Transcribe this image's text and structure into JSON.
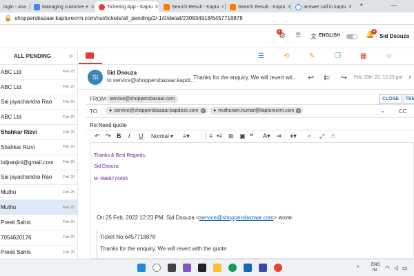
{
  "browser": {
    "tabs": [
      {
        "label": "login - ana",
        "color": "#f2a900"
      },
      {
        "label": "Managing customer e",
        "color": "#4285f4"
      },
      {
        "label": "Ticketing App - Kaptu",
        "color": "#e53935"
      },
      {
        "label": "Search Result - Kaptu",
        "color": "#f57c00"
      },
      {
        "label": "Search Result - Kaptu",
        "color": "#f57c00"
      },
      {
        "label": "answer call in kaptu",
        "color": "#4285f4"
      }
    ],
    "new_tab": "+",
    "url": "shoppersbazaar.kapturecrm.com/nui/tickets/all_pending/2/-1/0/detail/230834918/6457718878"
  },
  "app_header": {
    "notif_count": "6",
    "language": "ENGLISH",
    "user_name": "Sid Dsouza"
  },
  "list": {
    "title": "ALL PENDING",
    "items": [
      {
        "name": "ABC Ltd",
        "date": "Feb 25",
        "bold": false,
        "selected": false
      },
      {
        "name": "ABC Ltd",
        "date": "Feb 25",
        "bold": false,
        "selected": false
      },
      {
        "name": "Sai jayachandra Rao",
        "date": "Feb 25",
        "bold": false,
        "selected": false
      },
      {
        "name": "ABC Ltd",
        "date": "Feb 25",
        "bold": false,
        "selected": false
      },
      {
        "name": "Shahkar Rizvi",
        "date": "Feb 25",
        "bold": true,
        "selected": false
      },
      {
        "name": "Shahkar Rizvi",
        "date": "Feb 25",
        "bold": false,
        "selected": false
      },
      {
        "name": "bdjranjini@gmail.com",
        "date": "Feb 25",
        "bold": false,
        "selected": false
      },
      {
        "name": "Sai jayachandra Rao",
        "date": "Feb 25",
        "bold": false,
        "selected": false
      },
      {
        "name": "Muthu",
        "date": "Feb 25",
        "bold": false,
        "selected": false
      },
      {
        "name": "Muthu",
        "date": "Feb 25",
        "bold": false,
        "selected": true
      },
      {
        "name": "Preeti Sahni",
        "date": "Feb 25",
        "bold": false,
        "selected": false
      },
      {
        "name": "7054620176",
        "date": "Feb 25",
        "bold": false,
        "selected": false
      },
      {
        "name": "Preeti Sahni",
        "date": "Feb 25",
        "bold": false,
        "selected": false
      }
    ]
  },
  "mail": {
    "avatar": "SI",
    "sender": "Sid Dsouza",
    "to_line": "to service@shoppersbazaar.kapdt...",
    "preview": "Thanks for the enquiry. We will revert wit...",
    "date": "Feb 25th 22, 12:23 pm"
  },
  "compose": {
    "from_label": "FROM",
    "from_value": "service@shoppersbazaar.com",
    "to_label": "TO",
    "to_chips": [
      "service@shoppersbazaar.kapdesk.com",
      "muthuram.kumar@kapturecrm.com"
    ],
    "cc_label": "CC",
    "close_label": "CLOSE",
    "template_label": "TEM",
    "subject": "Re:Need quote",
    "format_select": "Normal"
  },
  "body": {
    "sig1": "Thanks & Best Regards,",
    "sig2": "Sid Dsouza",
    "sig3": "M -9988774455",
    "quote_prefix": "On 25 Feb, 2022 12:23 PM, Sid Dsouza <",
    "quote_email": "service@shoppersbazaar.com",
    "quote_suffix": "> wrote:",
    "ticket_no": "Ticket No:6457718878",
    "quoted_text": "Thanks for the enquiry. We will revert with the quote"
  },
  "taskbar": {
    "lang1": "ENG",
    "lang2": "IN"
  }
}
